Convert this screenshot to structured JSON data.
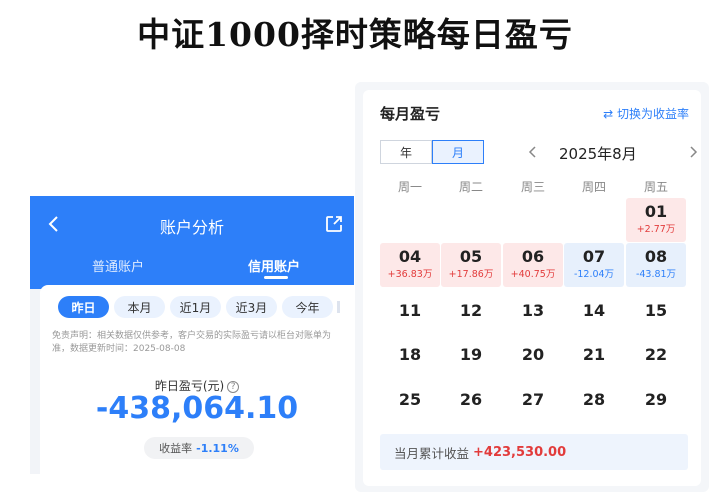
{
  "title": "中证1000择时策略每日盈亏",
  "left": {
    "header_title": "账户分析",
    "account_tabs": [
      "普通账户",
      "信用账户"
    ],
    "active_account_tab": "信用账户",
    "period_tabs": [
      "昨日",
      "本月",
      "近1月",
      "近3月",
      "今年"
    ],
    "active_period_tab": "昨日",
    "disclaimer": "免责声明：相关数据仅供参考，客户交易的实际盈亏请以柜台对账单为准，数据更新时间：2025-08-08",
    "yesterday_label": "昨日盈亏(元)",
    "help_icon": "?",
    "yesterday_value": "-438,064.10",
    "rate_label": "收益率",
    "rate_value": "-1.11%"
  },
  "right": {
    "title": "每月盈亏",
    "toggle_label": "⇄ 切换为收益率",
    "segment": [
      "年",
      "月"
    ],
    "active_segment": "月",
    "month_label": "2025年8月",
    "weekdays": [
      "周一",
      "周二",
      "周三",
      "周四",
      "周五"
    ],
    "days": [
      {
        "day": "01",
        "value": "+2.77万",
        "tone": "pos"
      },
      {
        "day": "04",
        "value": "+36.83万",
        "tone": "pos"
      },
      {
        "day": "05",
        "value": "+17.86万",
        "tone": "pos"
      },
      {
        "day": "06",
        "value": "+40.75万",
        "tone": "pos"
      },
      {
        "day": "07",
        "value": "-12.04万",
        "tone": "neg"
      },
      {
        "day": "08",
        "value": "-43.81万",
        "tone": "neg"
      },
      {
        "day": "11",
        "value": "",
        "tone": "plain"
      },
      {
        "day": "12",
        "value": "",
        "tone": "plain"
      },
      {
        "day": "13",
        "value": "",
        "tone": "plain"
      },
      {
        "day": "14",
        "value": "",
        "tone": "plain"
      },
      {
        "day": "15",
        "value": "",
        "tone": "plain"
      },
      {
        "day": "18",
        "value": "",
        "tone": "plain"
      },
      {
        "day": "19",
        "value": "",
        "tone": "plain"
      },
      {
        "day": "20",
        "value": "",
        "tone": "plain"
      },
      {
        "day": "21",
        "value": "",
        "tone": "plain"
      },
      {
        "day": "22",
        "value": "",
        "tone": "plain"
      },
      {
        "day": "25",
        "value": "",
        "tone": "plain"
      },
      {
        "day": "26",
        "value": "",
        "tone": "plain"
      },
      {
        "day": "27",
        "value": "",
        "tone": "plain"
      },
      {
        "day": "28",
        "value": "",
        "tone": "plain"
      },
      {
        "day": "29",
        "value": "",
        "tone": "plain"
      }
    ],
    "summary_label": "当月累计收益",
    "summary_value": "+423,530.00"
  },
  "colors": {
    "brand_blue": "#2d7ff9",
    "profit_red": "#e23b3b",
    "profit_bg": "#fde8e8",
    "loss_bg": "#e7f0fc"
  },
  "icons": [
    "back-arrow-icon",
    "share-icon",
    "help-icon",
    "swap-icon",
    "chevron-left-icon",
    "chevron-right-icon"
  ]
}
